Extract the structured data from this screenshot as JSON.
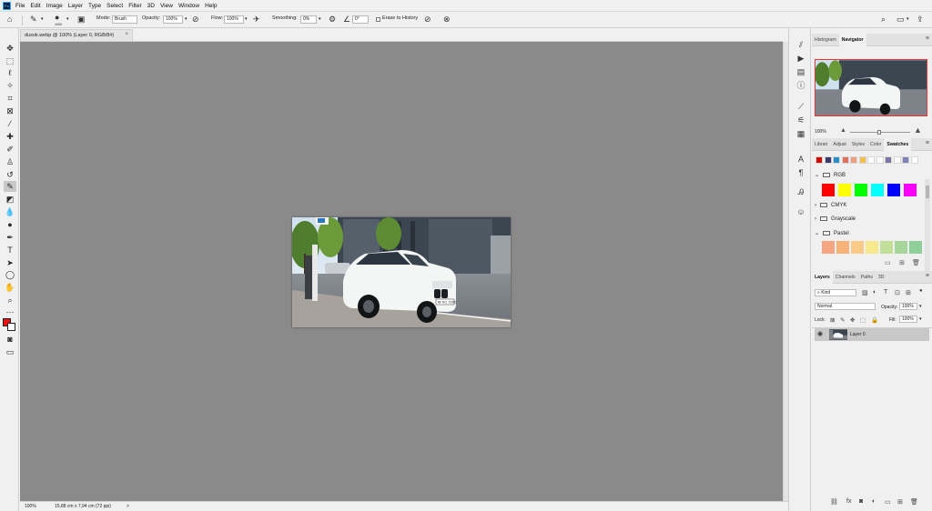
{
  "app": {
    "logo_text": "Ps"
  },
  "menu": [
    "File",
    "Edit",
    "Image",
    "Layer",
    "Type",
    "Select",
    "Filter",
    "3D",
    "View",
    "Window",
    "Help"
  ],
  "window_controls": {
    "search_icon": "search-icon",
    "workspace_icon": "workspace-icon",
    "share_icon": "share-icon"
  },
  "options": {
    "brush_size": "1000",
    "mode_label": "Mode:",
    "mode_value": "Brush",
    "opacity_label": "Opacity:",
    "opacity_value": "100%",
    "flow_label": "Flow:",
    "flow_value": "100%",
    "smoothing_label": "Smoothing:",
    "smoothing_value": "0%",
    "angle_value": "0°",
    "erase_history_label": "Erase to History"
  },
  "document": {
    "tab_title": "dusok.webp @ 100% (Layer 0, RGB/8#)",
    "close": "×"
  },
  "status": {
    "zoom": "100%",
    "doc_size": "15,88 cm x 7,94 cm (72 ppi)",
    "arrow": ">"
  },
  "navigator": {
    "tabs": [
      "Histogram",
      "Navigator"
    ],
    "active_tab": "Navigator",
    "zoom": "100%"
  },
  "swatches": {
    "tabs": [
      "Librari",
      "Adjust",
      "Styles",
      "Color",
      "Swatches"
    ],
    "active_tab": "Swatches",
    "recent_colors": [
      "#e00000",
      "#3a3a6a",
      "#2a8fc8",
      "#e07060",
      "#f0a080",
      "#f6c050",
      "#ffffff",
      "#ffffff",
      "#7878a8",
      "#ffffff",
      "#8080b8",
      "#ffffff"
    ],
    "groups": [
      {
        "name": "RGB",
        "expanded": true,
        "colors": [
          "#ff0000",
          "#ffff00",
          "#00ff00",
          "#00ffff",
          "#0000ff",
          "#ff00ff"
        ]
      },
      {
        "name": "CMYK",
        "expanded": false
      },
      {
        "name": "Grayscale",
        "expanded": false
      },
      {
        "name": "Pastel",
        "expanded": true,
        "colors": [
          "#f4a582",
          "#f7b27a",
          "#fbc98a",
          "#f7e98e",
          "#c3e09b",
          "#a8d59a",
          "#8ecf9a"
        ]
      }
    ]
  },
  "layers": {
    "tabs": [
      "Layers",
      "Channels",
      "Paths",
      "3D"
    ],
    "active_tab": "Layers",
    "filter_kind": "Kind",
    "blend_mode": "Normal",
    "opacity_label": "Opacity:",
    "opacity_value": "100%",
    "lock_label": "Lock:",
    "fill_label": "Fill:",
    "fill_value": "100%",
    "items": [
      {
        "name": "Layer 0",
        "visible": true
      }
    ]
  },
  "photo": {
    "plate_text": "M·XC 720C"
  }
}
